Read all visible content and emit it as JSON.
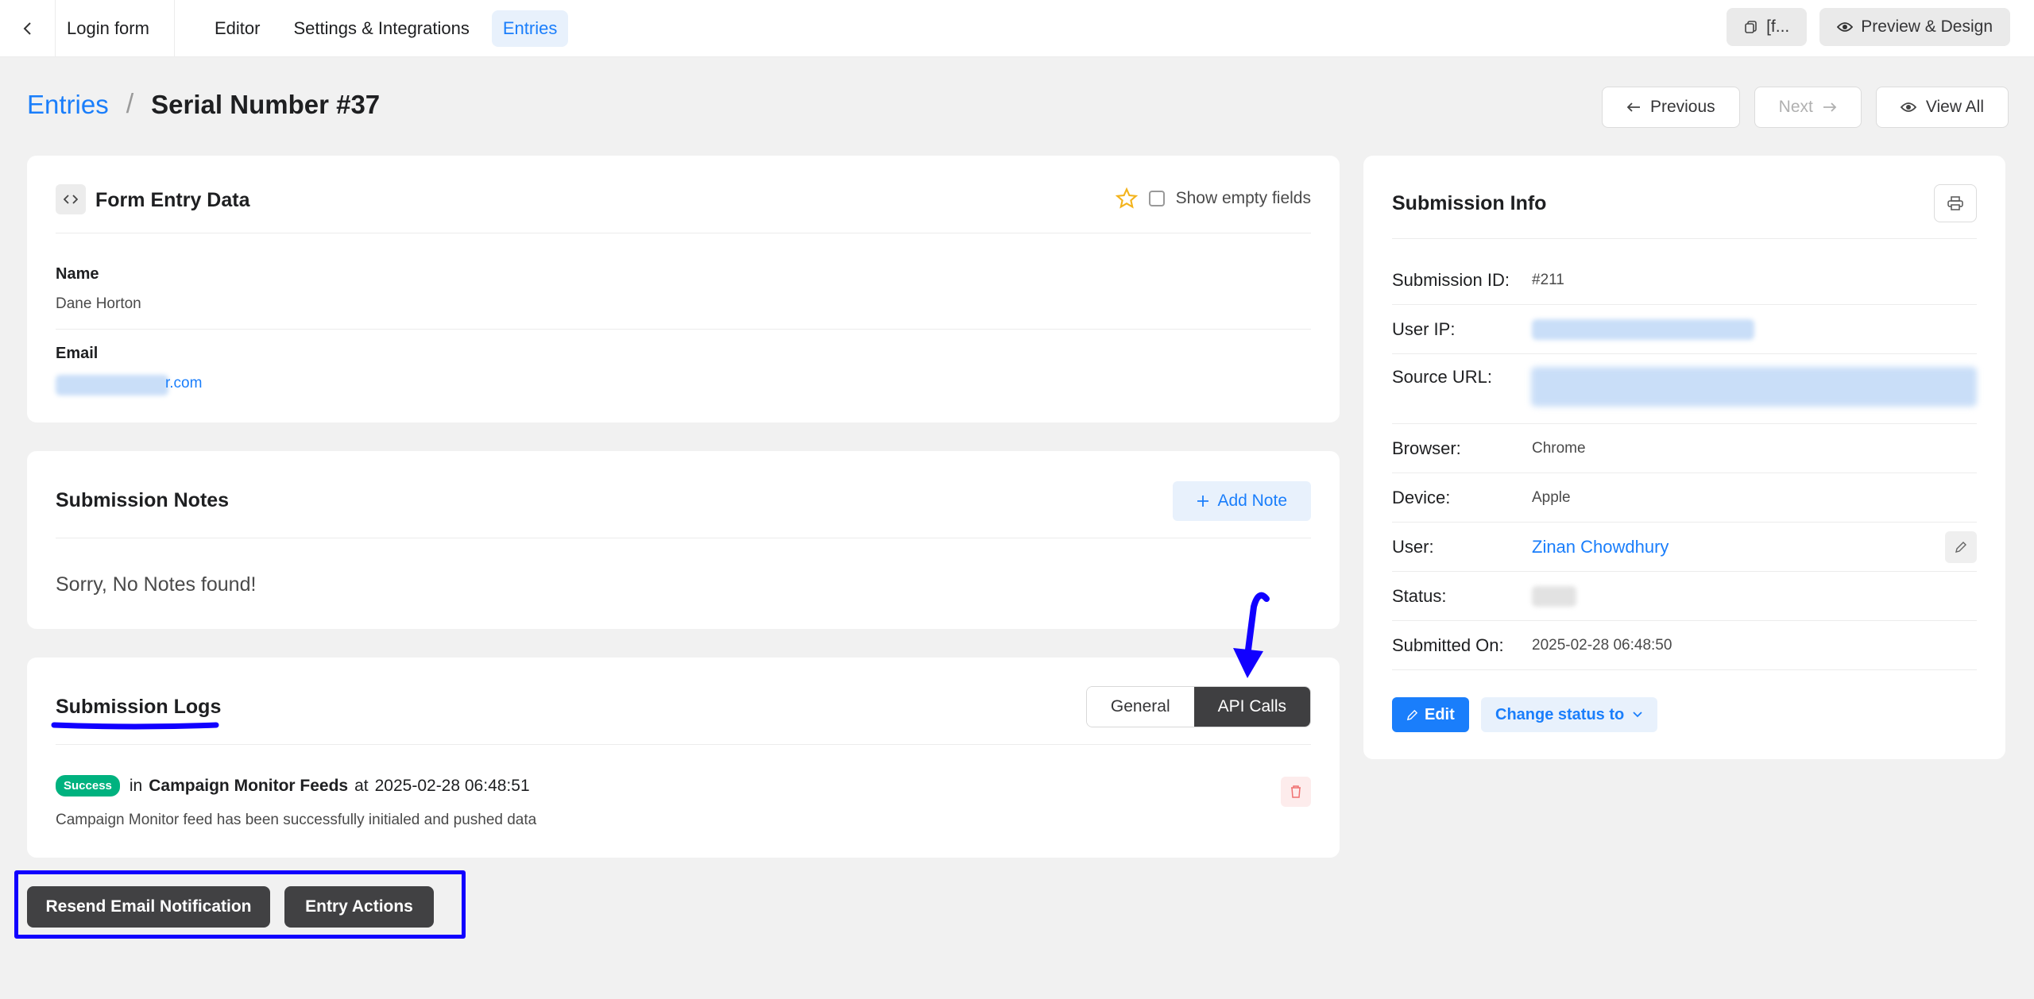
{
  "topbar": {
    "form_name": "Login form",
    "tabs": [
      {
        "label": "Editor"
      },
      {
        "label": "Settings & Integrations"
      },
      {
        "label": "Entries"
      }
    ],
    "shortcode_label": "[f...",
    "preview_label": "Preview & Design"
  },
  "header": {
    "breadcrumb_link": "Entries",
    "separator": "/",
    "title": "Serial Number #37",
    "previous_label": "Previous",
    "next_label": "Next",
    "view_all_label": "View All"
  },
  "entry_data": {
    "title": "Form Entry Data",
    "show_empty_label": "Show empty fields",
    "fields": [
      {
        "label": "Name",
        "value": "Dane Horton"
      },
      {
        "label": "Email",
        "value": "r.com"
      }
    ]
  },
  "notes": {
    "title": "Submission Notes",
    "add_label": "Add Note",
    "empty_text": "Sorry, No Notes found!"
  },
  "logs": {
    "title": "Submission Logs",
    "tabs": [
      "General",
      "API Calls"
    ],
    "entries": [
      {
        "status": "Success",
        "prefix": "in",
        "source": "Campaign Monitor Feeds",
        "at_word": "at",
        "time": "2025-02-28 06:48:51",
        "message": "Campaign Monitor feed has been successfully initialed and pushed data"
      }
    ]
  },
  "actions": {
    "resend_label": "Resend Email Notification",
    "entry_actions_label": "Entry Actions"
  },
  "submission_info": {
    "title": "Submission Info",
    "rows": [
      {
        "label": "Submission ID:",
        "value": "#211"
      },
      {
        "label": "User IP:",
        "value": ""
      },
      {
        "label": "Source URL:",
        "value": ""
      },
      {
        "label": "Browser:",
        "value": "Chrome"
      },
      {
        "label": "Device:",
        "value": "Apple"
      },
      {
        "label": "User:",
        "value": "Zinan Chowdhury"
      },
      {
        "label": "Status:",
        "value": ""
      },
      {
        "label": "Submitted On:",
        "value": "2025-02-28 06:48:50"
      }
    ],
    "edit_label": "Edit",
    "change_status_label": "Change status to"
  },
  "colors": {
    "accent": "#1a7efb",
    "annotation": "#1100ff",
    "success": "#00b27f"
  }
}
